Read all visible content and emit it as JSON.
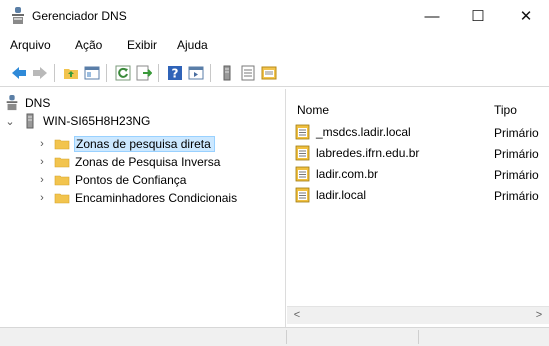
{
  "window": {
    "title": "Gerenciador DNS",
    "controls": {
      "minimize": "—",
      "maximize": "☐",
      "close": "✕"
    }
  },
  "menu": [
    "Arquivo",
    "Ação",
    "Exibir",
    "Ajuda"
  ],
  "toolbar": {
    "icons": [
      "back-arrow-icon",
      "forward-arrow-icon",
      "up-folder-icon",
      "show-hide-tree-icon",
      "refresh-icon",
      "export-list-icon",
      "help-icon",
      "console-view-icon",
      "server-icon",
      "list-view-icon",
      "properties-icon"
    ]
  },
  "tree": {
    "root": "DNS",
    "server": "WIN-SI65H8H23NG",
    "items": [
      "Zonas de pesquisa direta",
      "Zonas de Pesquisa Inversa",
      "Pontos de Confiança",
      "Encaminhadores Condicionais"
    ],
    "toggle_collapsed": "›",
    "toggle_expanded": "⌄"
  },
  "list": {
    "columns": [
      "Nome",
      "Tipo"
    ],
    "rows": [
      {
        "name": "_msdcs.ladir.local",
        "type": "Primário"
      },
      {
        "name": "labredes.ifrn.edu.br",
        "type": "Primário"
      },
      {
        "name": "ladir.com.br",
        "type": "Primário"
      },
      {
        "name": "ladir.local",
        "type": "Primário"
      }
    ]
  },
  "scrollbar": {
    "left": "<",
    "right": ">"
  },
  "colors": {
    "selection_bg": "#cce8ff",
    "folder": "#f2c44e",
    "zone_icon": "#d9a520"
  }
}
